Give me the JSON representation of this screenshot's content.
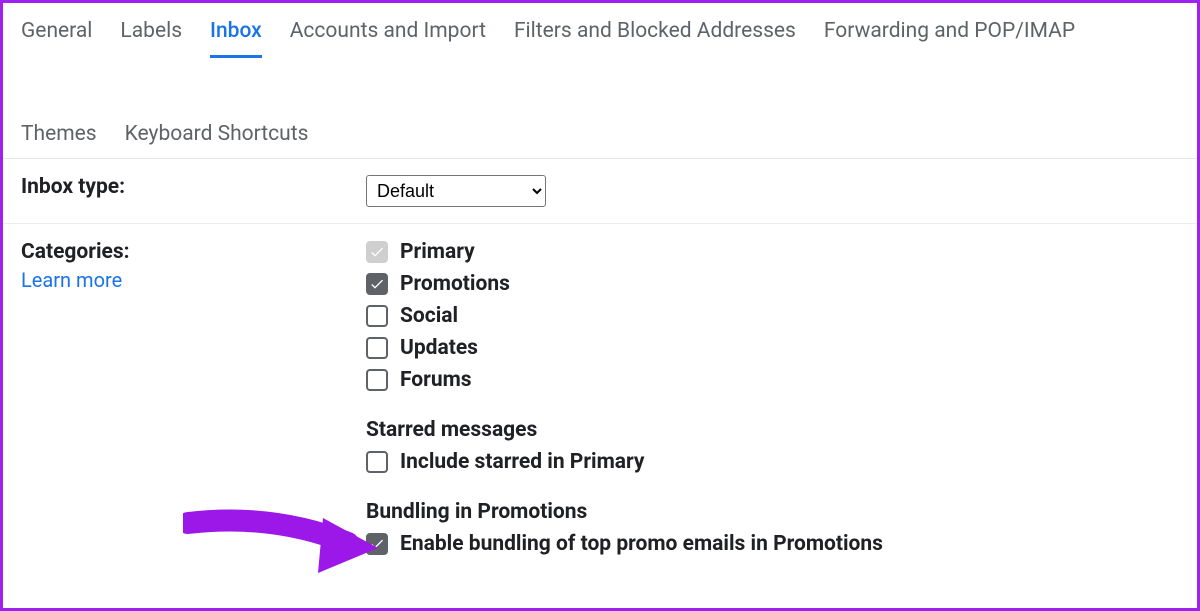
{
  "tabs": {
    "row1": [
      "General",
      "Labels",
      "Inbox",
      "Accounts and Import",
      "Filters and Blocked Addresses",
      "Forwarding and POP/IMAP"
    ],
    "row2": [
      "Themes",
      "Keyboard Shortcuts"
    ],
    "active": "Inbox"
  },
  "inbox_type": {
    "label": "Inbox type:",
    "value": "Default"
  },
  "categories": {
    "label": "Categories:",
    "learn_more": "Learn more",
    "items": [
      {
        "label": "Primary",
        "checked": true,
        "disabled": true
      },
      {
        "label": "Promotions",
        "checked": true,
        "disabled": false
      },
      {
        "label": "Social",
        "checked": false,
        "disabled": false
      },
      {
        "label": "Updates",
        "checked": false,
        "disabled": false
      },
      {
        "label": "Forums",
        "checked": false,
        "disabled": false
      }
    ],
    "starred": {
      "heading": "Starred messages",
      "item": {
        "label": "Include starred in Primary",
        "checked": false
      }
    },
    "bundling": {
      "heading": "Bundling in Promotions",
      "item": {
        "label": "Enable bundling of top promo emails in Promotions",
        "checked": true
      }
    }
  }
}
